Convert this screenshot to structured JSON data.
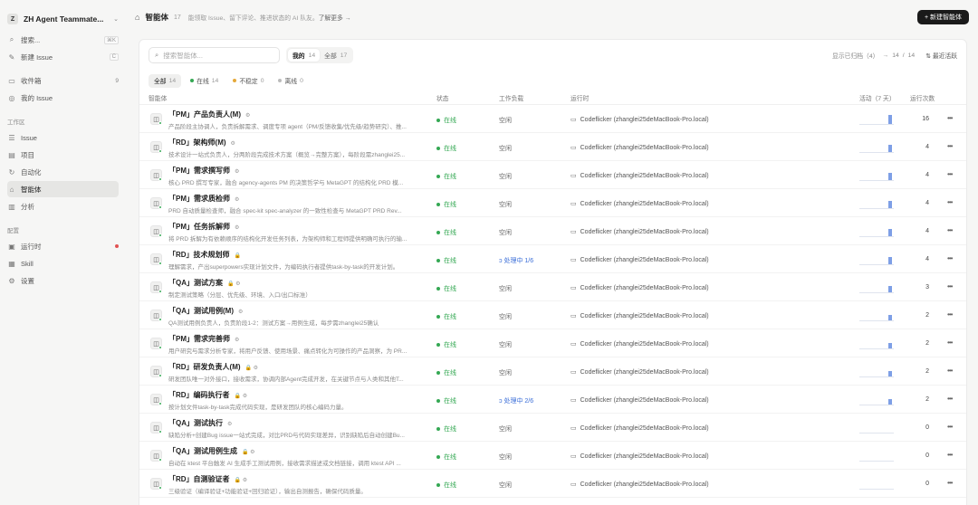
{
  "workspace": {
    "badge": "Z",
    "name": "ZH Agent Teammate..."
  },
  "sidebar": {
    "top": [
      {
        "icon": "search-icon",
        "label": "搜索...",
        "kbd": "⌘K"
      },
      {
        "icon": "new-issue-icon",
        "label": "新建 Issue",
        "kbd": "C"
      }
    ],
    "main": [
      {
        "icon": "inbox-icon",
        "label": "收件箱",
        "count": "9"
      },
      {
        "icon": "my-issue-icon",
        "label": "我的 Issue",
        "count": ""
      }
    ],
    "workspace_title": "工作区",
    "workspace_items": [
      {
        "icon": "issue-icon",
        "label": "Issue"
      },
      {
        "icon": "project-icon",
        "label": "项目"
      },
      {
        "icon": "automation-icon",
        "label": "自动化"
      },
      {
        "icon": "agent-icon",
        "label": "智能体",
        "active": true
      },
      {
        "icon": "analytics-icon",
        "label": "分析"
      }
    ],
    "config_title": "配置",
    "config_items": [
      {
        "icon": "runtime-icon",
        "label": "运行时",
        "alert": true
      },
      {
        "icon": "skill-icon",
        "label": "Skill"
      },
      {
        "icon": "settings-icon",
        "label": "设置"
      }
    ]
  },
  "header": {
    "title": "智能体",
    "count": "17",
    "desc": "能领取 Issue、留下评论、推进状态的 AI 队友。",
    "more": "了解更多 →",
    "new_button": "+ 新建智能体"
  },
  "filters": {
    "search_placeholder": "搜索智能体...",
    "scope": [
      {
        "label": "我的",
        "count": "14",
        "on": true
      },
      {
        "label": "全部",
        "count": "17",
        "on": false
      }
    ],
    "archived": "显示已归档（4）",
    "pager_current": "14",
    "pager_sep": "/",
    "pager_total": "14",
    "sort": "最近活跃"
  },
  "status_chips": [
    {
      "label": "全部",
      "count": "14",
      "color": "",
      "on": true
    },
    {
      "label": "在线",
      "count": "14",
      "color": "#34a853",
      "on": false
    },
    {
      "label": "不稳定",
      "count": "0",
      "color": "#e5a93a",
      "on": false
    },
    {
      "label": "离线",
      "count": "0",
      "color": "#bbbbbb",
      "on": false
    }
  ],
  "columns": {
    "agent": "智能体",
    "status": "状态",
    "load": "工作负载",
    "runtime": "运行时",
    "activity": "活动（7 天）",
    "runs": "运行次数"
  },
  "rows": [
    {
      "name": "「PM」产品负责人(M)",
      "tag": "⚙",
      "desc": "产品阶段主协调人，负责拆解需求、调度专项 agent（PM/反馈收集/优先级/趋势研究）、推...",
      "status": "在线",
      "load": "空闲",
      "busy": false,
      "runtime": "Codeflicker (zhanglei25deMacBook-Pro.local)",
      "activity": 0.85,
      "runs": "16"
    },
    {
      "name": "「RD」架构师(M)",
      "tag": "⚙",
      "desc": "技术设计一站式负责人，分两阶段完成技术方案（概览→完整方案），每阶段需zhanglei25...",
      "status": "在线",
      "load": "空闲",
      "busy": false,
      "runtime": "Codeflicker (zhanglei25deMacBook-Pro.local)",
      "activity": 0.7,
      "runs": "4"
    },
    {
      "name": "「PM」需求撰写师",
      "tag": "⚙",
      "desc": "核心 PRD 撰写专家，融合 agency-agents PM 的决策哲学与 MetaGPT 的结构化 PRD 模...",
      "status": "在线",
      "load": "空闲",
      "busy": false,
      "runtime": "Codeflicker (zhanglei25deMacBook-Pro.local)",
      "activity": 0.7,
      "runs": "4"
    },
    {
      "name": "「PM」需求质检师",
      "tag": "⚙",
      "desc": "PRD 自动质量检查师，融合 spec-kit spec-analyzer 的一致性检查与 MetaGPT PRD Rev...",
      "status": "在线",
      "load": "空闲",
      "busy": false,
      "runtime": "Codeflicker (zhanglei25deMacBook-Pro.local)",
      "activity": 0.7,
      "runs": "4"
    },
    {
      "name": "「PM」任务拆解师",
      "tag": "⚙",
      "desc": "将 PRD 拆解为有依赖顺序的结构化开发任务列表，为架构师和工程师提供明确可执行的输...",
      "status": "在线",
      "load": "空闲",
      "busy": false,
      "runtime": "Codeflicker (zhanglei25deMacBook-Pro.local)",
      "activity": 0.7,
      "runs": "4"
    },
    {
      "name": "「RD」技术规划师",
      "tag": "🔒",
      "desc": "理解需求，产出superpowers实现计划文件，为编码执行者提供task-by-task的开发计划。",
      "status": "在线",
      "load": "处理中 1/6",
      "busy": true,
      "runtime": "Codeflicker (zhanglei25deMacBook-Pro.local)",
      "activity": 0.7,
      "runs": "4"
    },
    {
      "name": "「QA」测试方案",
      "tag": "🔒 ⚙",
      "desc": "制定测试策略（分层、优先级、环境、入口/出口标准）",
      "status": "在线",
      "load": "空闲",
      "busy": false,
      "runtime": "Codeflicker (zhanglei25deMacBook-Pro.local)",
      "activity": 0.6,
      "runs": "3"
    },
    {
      "name": "「QA」测试用例(M)",
      "tag": "⚙",
      "desc": "QA测试用例负责人，负责阶段1-2：测试方案→用例生成，每步需zhanglei25确认",
      "status": "在线",
      "load": "空闲",
      "busy": false,
      "runtime": "Codeflicker (zhanglei25deMacBook-Pro.local)",
      "activity": 0.5,
      "runs": "2"
    },
    {
      "name": "「PM」需求完善师",
      "tag": "⚙",
      "desc": "用户研究与需求分析专家，将用户反馈、使用场景、痛点转化为可操作的产品洞察，为 PR...",
      "status": "在线",
      "load": "空闲",
      "busy": false,
      "runtime": "Codeflicker (zhanglei25deMacBook-Pro.local)",
      "activity": 0.5,
      "runs": "2"
    },
    {
      "name": "「RD」研发负责人(M)",
      "tag": "🔒 ⚙",
      "desc": "研发团队唯一对外接口，接收需求，协调内部Agent完成开发，在关键节点与人类和其他T...",
      "status": "在线",
      "load": "空闲",
      "busy": false,
      "runtime": "Codeflicker (zhanglei25deMacBook-Pro.local)",
      "activity": 0.5,
      "runs": "2"
    },
    {
      "name": "「RD」编码执行者",
      "tag": "🔒 ⚙",
      "desc": "按计划文件task-by-task完成代码实现，是研发团队的核心编码力量。",
      "status": "在线",
      "load": "处理中 2/6",
      "busy": true,
      "runtime": "Codeflicker (zhanglei25deMacBook-Pro.local)",
      "activity": 0.5,
      "runs": "2"
    },
    {
      "name": "「QA」测试执行",
      "tag": "⚙",
      "desc": "缺陷分析+创建Bug issue一站式完成，对比PRD与代码实现差异，识别缺陷后自动创建Bu...",
      "status": "在线",
      "load": "空闲",
      "busy": false,
      "runtime": "Codeflicker (zhanglei25deMacBook-Pro.local)",
      "activity": 0,
      "runs": "0"
    },
    {
      "name": "「QA」测试用例生成",
      "tag": "🔒 ⚙",
      "desc": "自动在 ktest 平台触发 AI 生成手工测试用例，接收需求描述或文档链接，调用 ktest API ...",
      "status": "在线",
      "load": "空闲",
      "busy": false,
      "runtime": "Codeflicker (zhanglei25deMacBook-Pro.local)",
      "activity": 0,
      "runs": "0"
    },
    {
      "name": "「RD」自测验证者",
      "tag": "🔒 ⚙",
      "desc": "三级验证（编译验证+功能验证+回归验证），输出自测报告，确保代码质量。",
      "status": "在线",
      "load": "空闲",
      "busy": false,
      "runtime": "Codeflicker (zhanglei25deMacBook-Pro.local)",
      "activity": 0,
      "runs": "0"
    }
  ]
}
